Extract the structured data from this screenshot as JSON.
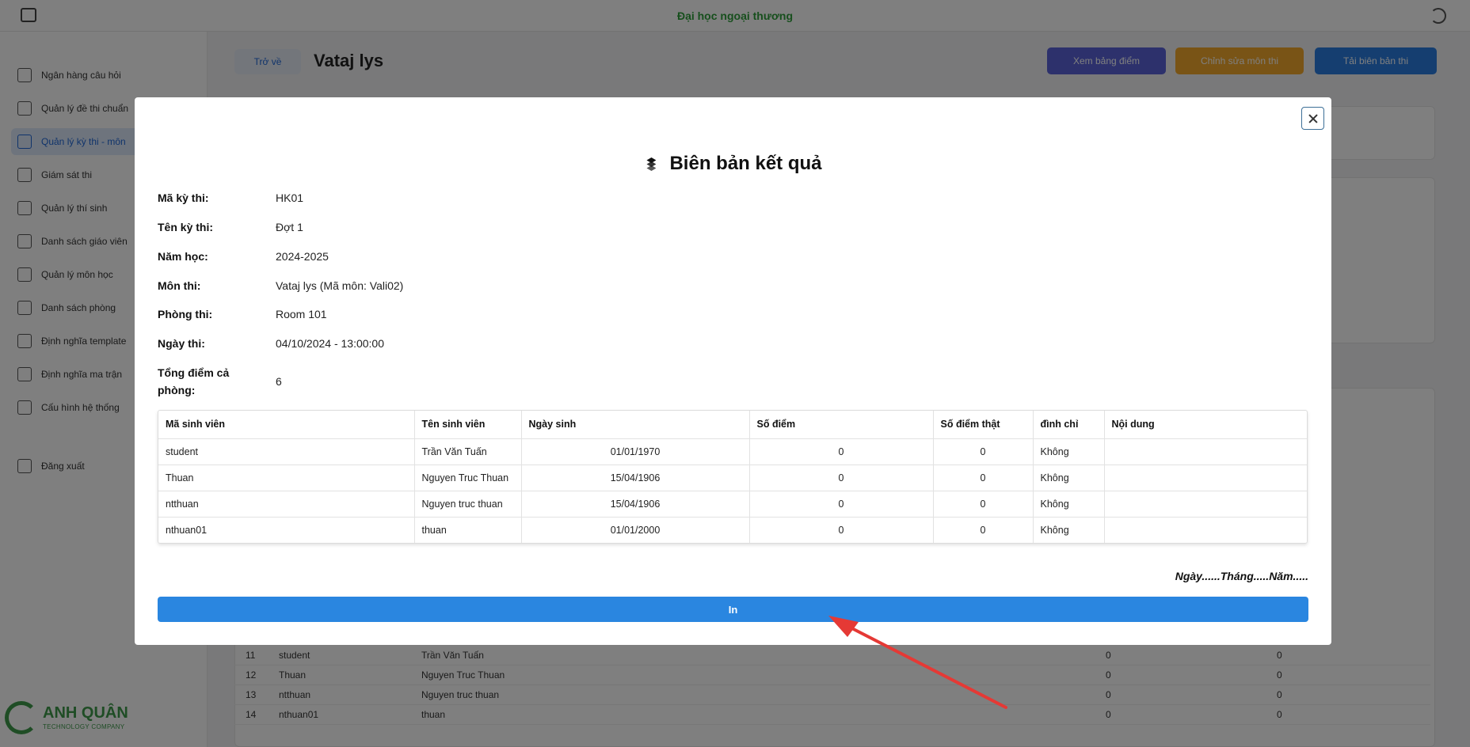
{
  "topbar": {
    "brand": "Đại học ngoại thương"
  },
  "sidebar": {
    "items": [
      {
        "label": "Ngân hàng câu hỏi"
      },
      {
        "label": "Quản lý đề thi chuẩn"
      },
      {
        "label": "Quản lý kỳ thi - môn"
      },
      {
        "label": "Giám sát thi"
      },
      {
        "label": "Quản lý thí sinh"
      },
      {
        "label": "Danh sách giáo viên"
      },
      {
        "label": "Quản lý môn học"
      },
      {
        "label": "Danh sách phòng"
      },
      {
        "label": "Định nghĩa template"
      },
      {
        "label": "Định nghĩa ma trận"
      },
      {
        "label": "Cấu hình hệ thống"
      },
      {
        "label": "Đăng xuất"
      }
    ],
    "logo_title": "ANH QUÂN",
    "logo_sub": "TECHNOLOGY COMPANY"
  },
  "page": {
    "back_label": "Trở về",
    "title": "Vataj lys",
    "btn_scores": "Xem bảng điểm",
    "btn_edit": "Chỉnh sửa môn thi",
    "btn_report": "Tải biên bản thi",
    "bg_rows": [
      {
        "idx": "11",
        "id": "student",
        "name": "Trần Văn Tuấn",
        "a": "0",
        "b": "0"
      },
      {
        "idx": "12",
        "id": "Thuan",
        "name": "Nguyen Truc Thuan",
        "a": "0",
        "b": "0"
      },
      {
        "idx": "13",
        "id": "ntthuan",
        "name": "Nguyen truc thuan",
        "a": "0",
        "b": "0"
      },
      {
        "idx": "14",
        "id": "nthuan01",
        "name": "thuan",
        "a": "0",
        "b": "0"
      }
    ]
  },
  "modal": {
    "title": "Biên bản kết quả",
    "info": [
      {
        "label": "Mã kỳ thi:",
        "value": "HK01"
      },
      {
        "label": "Tên kỳ thi:",
        "value": "Đợt 1"
      },
      {
        "label": "Năm học:",
        "value": "2024-2025"
      },
      {
        "label": "Môn thi:",
        "value": "Vataj lys (Mã môn: Vali02)"
      },
      {
        "label": "Phòng thi:",
        "value": "Room 101"
      },
      {
        "label": "Ngày thi:",
        "value": "04/10/2024 - 13:00:00"
      },
      {
        "label": "Tổng điểm cả phòng:",
        "value": "6"
      }
    ],
    "table": {
      "headers": [
        "Mã sinh viên",
        "Tên sinh viên",
        "Ngày sinh",
        "Số điểm",
        "Số điểm thật",
        "đình chỉ",
        "Nội dung"
      ],
      "rows": [
        [
          "student",
          "Trần Văn Tuấn",
          "01/01/1970",
          "0",
          "0",
          "Không",
          ""
        ],
        [
          "Thuan",
          "Nguyen Truc Thuan",
          "15/04/1906",
          "0",
          "0",
          "Không",
          ""
        ],
        [
          "ntthuan",
          "Nguyen truc thuan",
          "15/04/1906",
          "0",
          "0",
          "Không",
          ""
        ],
        [
          "nthuan01",
          "thuan",
          "01/01/2000",
          "0",
          "0",
          "Không",
          ""
        ]
      ]
    },
    "signature_line": "Ngày......Tháng.....Năm.....",
    "print_label": "In"
  },
  "colors": {
    "primary": "#2a86e0",
    "annotation_arrow": "#e53935"
  }
}
